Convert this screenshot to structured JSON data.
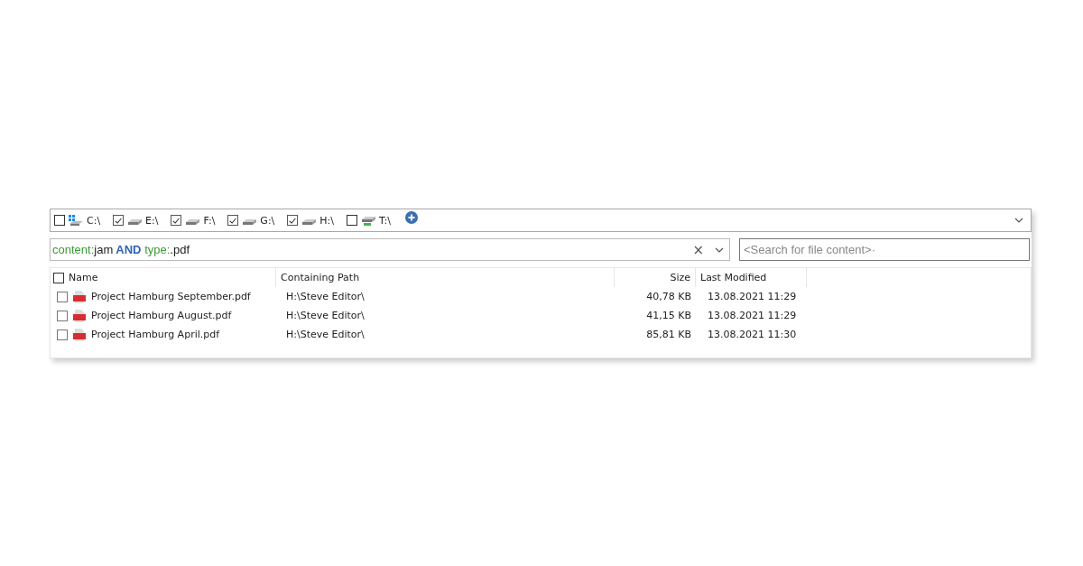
{
  "drives": [
    {
      "label": "C:\\",
      "checked": false,
      "kind": "system"
    },
    {
      "label": "E:\\",
      "checked": true,
      "kind": "disk"
    },
    {
      "label": "F:\\",
      "checked": true,
      "kind": "disk"
    },
    {
      "label": "G:\\",
      "checked": true,
      "kind": "disk"
    },
    {
      "label": "H:\\",
      "checked": true,
      "kind": "disk"
    },
    {
      "label": "T:\\",
      "checked": false,
      "kind": "network"
    }
  ],
  "query": [
    {
      "text": "content:",
      "kind": "field"
    },
    {
      "text": "jam",
      "kind": "value"
    },
    {
      "text": " AND ",
      "kind": "operator"
    },
    {
      "text": "type:",
      "kind": "field"
    },
    {
      "text": ".pdf",
      "kind": "value"
    }
  ],
  "clear_button": "×",
  "content_search": {
    "placeholder": "<Search for file content>·"
  },
  "table": {
    "select_all_checked": false,
    "columns": [
      "Name",
      "Containing Path",
      "Size",
      "Last Modified"
    ],
    "rows": [
      {
        "checked": false,
        "name": "Project Hamburg September.pdf",
        "path": "H:\\Steve Editor\\",
        "size": "40,78 KB",
        "modified": "13.08.2021 11:29"
      },
      {
        "checked": false,
        "name": "Project Hamburg August.pdf",
        "path": "H:\\Steve Editor\\",
        "size": "41,15 KB",
        "modified": "13.08.2021 11:29"
      },
      {
        "checked": false,
        "name": "Project Hamburg April.pdf",
        "path": "H:\\Steve Editor\\",
        "size": "85,81 KB",
        "modified": "13.08.2021 11:30"
      }
    ]
  }
}
